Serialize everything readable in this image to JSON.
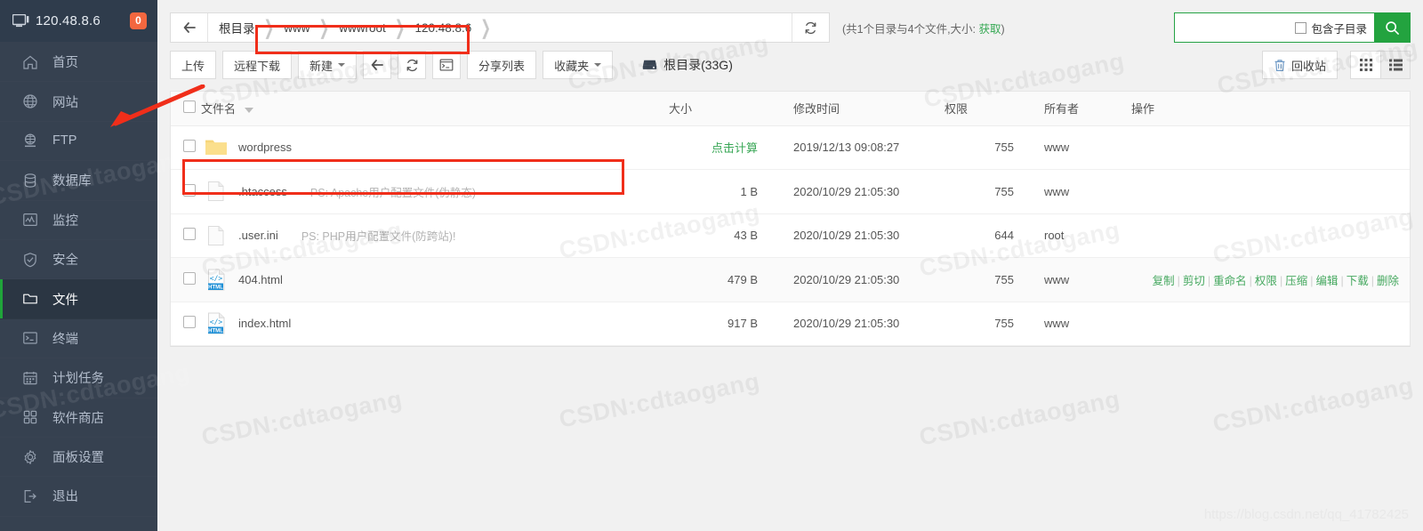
{
  "sidebar": {
    "host": "120.48.8.6",
    "badge": "0",
    "items": [
      {
        "label": "首页",
        "icon": "home-icon"
      },
      {
        "label": "网站",
        "icon": "globe-icon"
      },
      {
        "label": "FTP",
        "icon": "ftp-icon"
      },
      {
        "label": "数据库",
        "icon": "database-icon"
      },
      {
        "label": "监控",
        "icon": "monitor-chart-icon"
      },
      {
        "label": "安全",
        "icon": "shield-icon"
      },
      {
        "label": "文件",
        "icon": "folder-icon",
        "active": true
      },
      {
        "label": "终端",
        "icon": "terminal-icon"
      },
      {
        "label": "计划任务",
        "icon": "calendar-icon"
      },
      {
        "label": "软件商店",
        "icon": "apps-grid-icon"
      },
      {
        "label": "面板设置",
        "icon": "gear-icon"
      },
      {
        "label": "退出",
        "icon": "logout-icon"
      }
    ]
  },
  "pathbar": {
    "root_label": "根目录",
    "crumbs": [
      "www",
      "wwwroot",
      "120.48.8.6"
    ],
    "count_prefix": "(共1个目录与4个文件,大小:",
    "count_link": "获取",
    "count_suffix": ")"
  },
  "search": {
    "value": "",
    "placeholder": "",
    "subdir_label": "包含子目录"
  },
  "toolbar": {
    "upload": "上传",
    "remote_download": "远程下载",
    "new": "新建",
    "back_icon": "arrow-left-icon",
    "refresh_icon": "refresh-icon",
    "terminal_icon": "terminal-icon",
    "share_list": "分享列表",
    "favorites": "收藏夹",
    "disk": "根目录(33G)",
    "recycle_bin": "回收站",
    "view_grid_icon": "grid-view-icon",
    "view_list_icon": "list-view-icon"
  },
  "table": {
    "headers": {
      "name": "文件名",
      "size": "大小",
      "mtime": "修改时间",
      "perm": "权限",
      "owner": "所有者",
      "action": "操作"
    },
    "rows": [
      {
        "name": "wordpress",
        "note": "",
        "icon": "folder-icon",
        "size": "点击计算",
        "size_is_link": true,
        "mtime": "2019/12/13 09:08:27",
        "perm": "755",
        "owner": "www",
        "actions": []
      },
      {
        "name": ".htaccess",
        "note": "PS: Apache用户配置文件(伪静态)",
        "icon": "file-blank-icon",
        "size": "1 B",
        "size_is_link": false,
        "mtime": "2020/10/29 21:05:30",
        "perm": "755",
        "owner": "www",
        "actions": []
      },
      {
        "name": ".user.ini",
        "note": "PS: PHP用户配置文件(防跨站)!",
        "icon": "file-blank-icon",
        "size": "43 B",
        "size_is_link": false,
        "mtime": "2020/10/29 21:05:30",
        "perm": "644",
        "owner": "root",
        "actions": []
      },
      {
        "name": "404.html",
        "note": "",
        "icon": "html-file-icon",
        "size": "479 B",
        "size_is_link": false,
        "mtime": "2020/10/29 21:05:30",
        "perm": "755",
        "owner": "www",
        "highlighted": true,
        "actions": [
          "复制",
          "剪切",
          "重命名",
          "权限",
          "压缩",
          "编辑",
          "下载",
          "删除"
        ]
      },
      {
        "name": "index.html",
        "note": "",
        "icon": "html-file-icon",
        "size": "917 B",
        "size_is_link": false,
        "mtime": "2020/10/29 21:05:30",
        "perm": "755",
        "owner": "www",
        "actions": []
      }
    ]
  },
  "watermarks": {
    "text": "CSDN:cdtaogang",
    "bottom": "https://blog.csdn.net/qq_41782425"
  },
  "colors": {
    "sidebar_bg": "#364150",
    "sidebar_header_bg": "#2f3c4c",
    "accent_green": "#23a33f",
    "badge_orange": "#f3673f",
    "annotation_red": "#f02e1a"
  }
}
